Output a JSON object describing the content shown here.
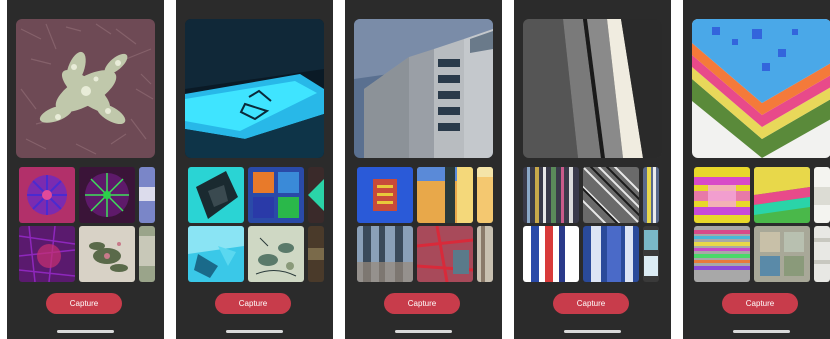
{
  "screens": [
    {
      "name": "Plant",
      "capture_label": "Capture"
    },
    {
      "name": "Pool",
      "capture_label": "Capture"
    },
    {
      "name": "Building",
      "capture_label": "Capture"
    },
    {
      "name": "Stripes",
      "capture_label": "Capture"
    },
    {
      "name": "Layers",
      "capture_label": "Capture"
    }
  ],
  "colors": {
    "phone_bg": "#2b2b2b",
    "button": "#c83c4b",
    "button_text": "#ffffff",
    "home_indicator": "#d9d9d9"
  },
  "icons": []
}
